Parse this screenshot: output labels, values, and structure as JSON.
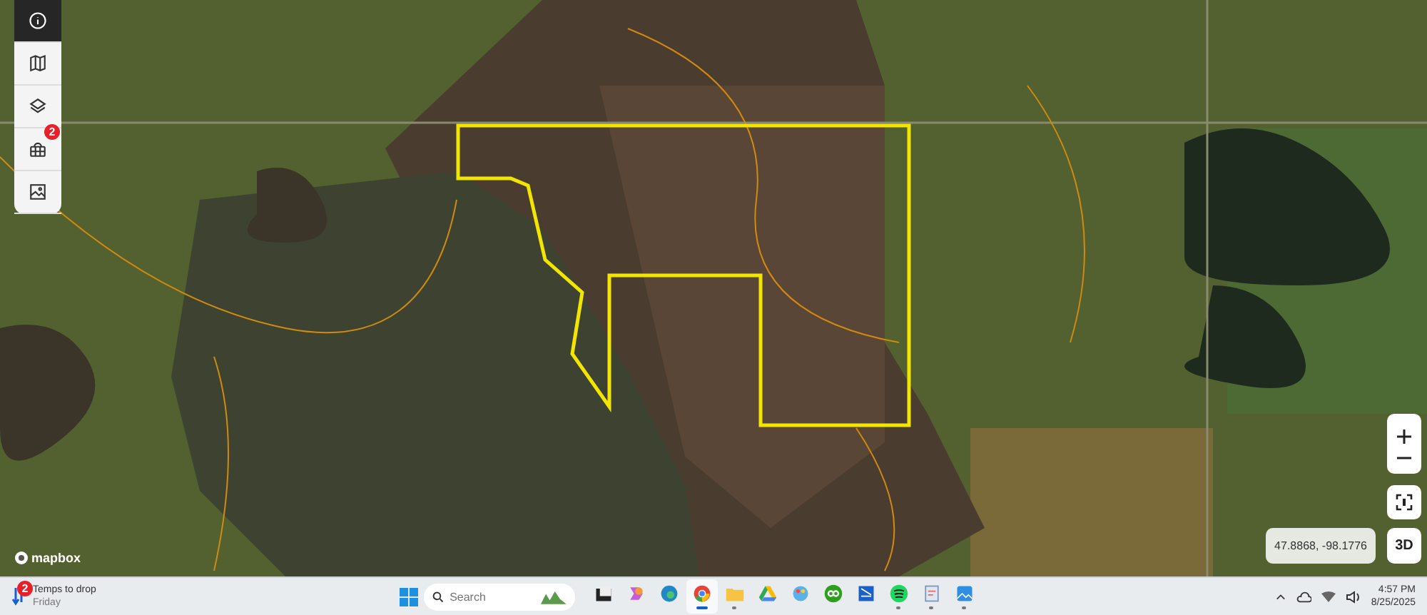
{
  "map_tools": [
    {
      "kind": "info",
      "selected": true
    },
    {
      "kind": "map",
      "selected": false
    },
    {
      "kind": "layers",
      "selected": false
    },
    {
      "kind": "parcels",
      "selected": false,
      "badge": "2"
    },
    {
      "kind": "image",
      "selected": false
    }
  ],
  "map_controls": {
    "coordinates": "47.8868, -98.1776",
    "view_toggle": "3D"
  },
  "attribution": "mapbox",
  "taskbar": {
    "weather": {
      "badge": "2",
      "title": "Temps to drop",
      "subtitle": "Friday"
    },
    "search": {
      "placeholder": "Search"
    },
    "apps": [
      {
        "kind": "tile",
        "running": false,
        "selected": false
      },
      {
        "kind": "copilot",
        "running": false,
        "selected": false
      },
      {
        "kind": "edge",
        "running": false,
        "selected": false
      },
      {
        "kind": "chrome",
        "running": true,
        "selected": true
      },
      {
        "kind": "folder",
        "running": true,
        "selected": false
      },
      {
        "kind": "drive",
        "running": false,
        "selected": false
      },
      {
        "kind": "paint",
        "running": false,
        "selected": false
      },
      {
        "kind": "qb",
        "running": false,
        "selected": false
      },
      {
        "kind": "scan",
        "running": false,
        "selected": false
      },
      {
        "kind": "spotify",
        "running": true,
        "selected": false
      },
      {
        "kind": "notes",
        "running": true,
        "selected": false
      },
      {
        "kind": "photos",
        "running": true,
        "selected": false
      }
    ],
    "time": "4:57 PM",
    "date": "8/25/2025"
  }
}
